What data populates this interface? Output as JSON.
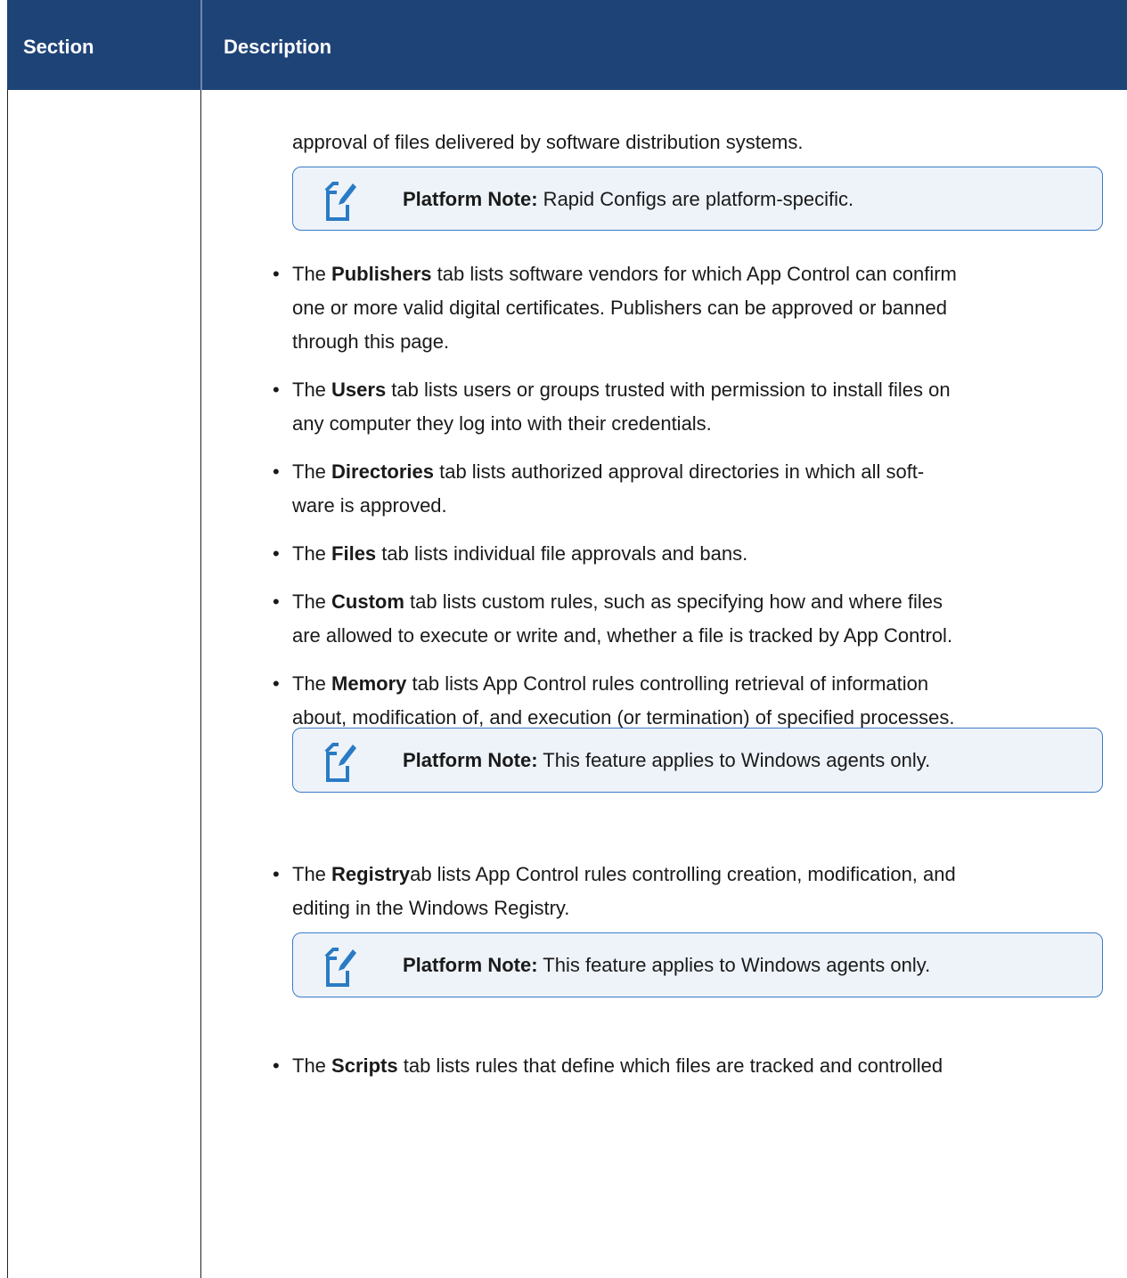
{
  "table": {
    "headers": {
      "section": "Section",
      "description": "Description"
    }
  },
  "content": {
    "continuation": "approval of files delivered by software distribution systems.",
    "notes": [
      {
        "label": "Platform Note:",
        "text": " Rapid Configs are platform-specific.",
        "icon": "note-edit-icon"
      },
      {
        "label": "Platform Note:",
        "text": " This feature applies to Windows agents only.",
        "icon": "note-edit-icon"
      },
      {
        "label": "Platform Note:",
        "text": " This feature applies to Windows agents only.",
        "icon": "note-edit-icon"
      }
    ],
    "bullets": [
      {
        "pre": "The ",
        "bold": "Publishers",
        "post": " tab lists software vendors for which App Control can confirm",
        "line2": "one or more valid digital certificates. Publishers can be approved or banned",
        "line3": "through this page."
      },
      {
        "pre": "The ",
        "bold": "Users",
        "post": " tab lists users or groups trusted with permission to install files on",
        "line2": "any computer they log into with their credentials."
      },
      {
        "pre": "The ",
        "bold": "Directories",
        "post": " tab lists authorized approval directories in which all soft-",
        "line2": "ware is approved."
      },
      {
        "pre": "The ",
        "bold": "Files",
        "post": " tab lists individual file approvals and bans."
      },
      {
        "pre": "The ",
        "bold": "Custom",
        "post": " tab lists custom rules, such as specifying how and where files",
        "line2": "are allowed to execute or write and, whether a file is tracked by App Control."
      },
      {
        "pre": "The ",
        "bold": "Memory",
        "post": " tab lists App Control rules controlling retrieval of information",
        "line2": "about, modification of, and execution (or termination) of specified processes."
      },
      {
        "pre": "The ",
        "bold": "Registry",
        "post": "ab lists App Control rules controlling creation, modification, and",
        "line2": "editing in the Windows Registry."
      },
      {
        "pre": "The ",
        "bold": "Scripts",
        "post": " tab lists rules that define which files are tracked and controlled"
      }
    ],
    "bullet_char": "•"
  }
}
